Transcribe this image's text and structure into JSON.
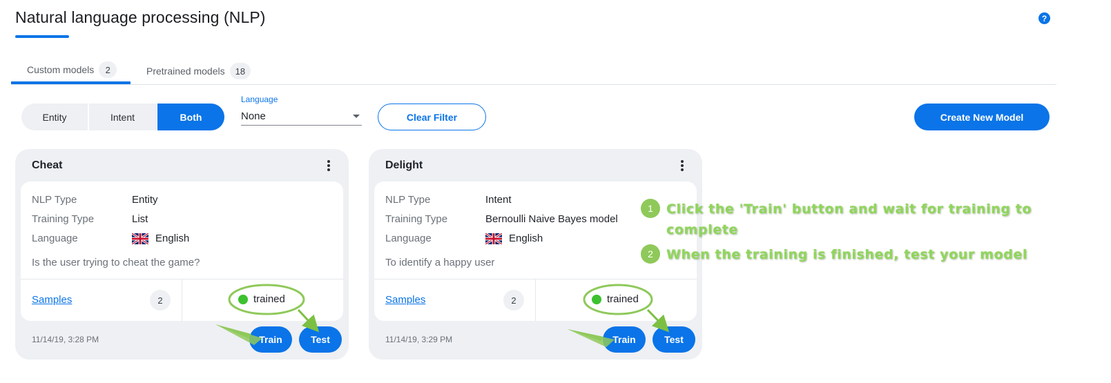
{
  "page": {
    "title": "Natural language processing (NLP)",
    "help_icon": "question-circle-icon"
  },
  "tabs": [
    {
      "label": "Custom models",
      "count": "2"
    },
    {
      "label": "Pretrained models",
      "count": "18"
    }
  ],
  "filters": {
    "types": [
      "Entity",
      "Intent",
      "Both"
    ],
    "active_type": "Both",
    "language_label": "Language",
    "language_value": "None",
    "clear_label": "Clear Filter"
  },
  "create_label": "Create New Model",
  "models": [
    {
      "name": "Cheat",
      "fields": [
        {
          "key": "NLP Type",
          "value": "Entity"
        },
        {
          "key": "Training Type",
          "value": "List"
        },
        {
          "key": "Language",
          "value": "English"
        }
      ],
      "description": "Is the user trying to cheat the game?",
      "samples_label": "Samples",
      "samples_count": "2",
      "status": "trained",
      "date": "11/14/19, 3:28 PM",
      "train_label": "Train",
      "test_label": "Test"
    },
    {
      "name": "Delight",
      "fields": [
        {
          "key": "NLP Type",
          "value": "Intent"
        },
        {
          "key": "Training Type",
          "value": "Bernoulli Naive Bayes model"
        },
        {
          "key": "Language",
          "value": "English"
        }
      ],
      "description": "To identify a happy user",
      "samples_label": "Samples",
      "samples_count": "2",
      "status": "trained",
      "date": "11/14/19, 3:29 PM",
      "train_label": "Train",
      "test_label": "Test"
    }
  ],
  "annotations": [
    {
      "number": "1",
      "text": "Click the 'Train' button and wait for training to complete"
    },
    {
      "number": "2",
      "text": "When the training is finished, test your model"
    }
  ],
  "colors": {
    "accent": "#0a74e8",
    "status_trained": "#3cc12f",
    "annotation": "#8fd65a"
  }
}
